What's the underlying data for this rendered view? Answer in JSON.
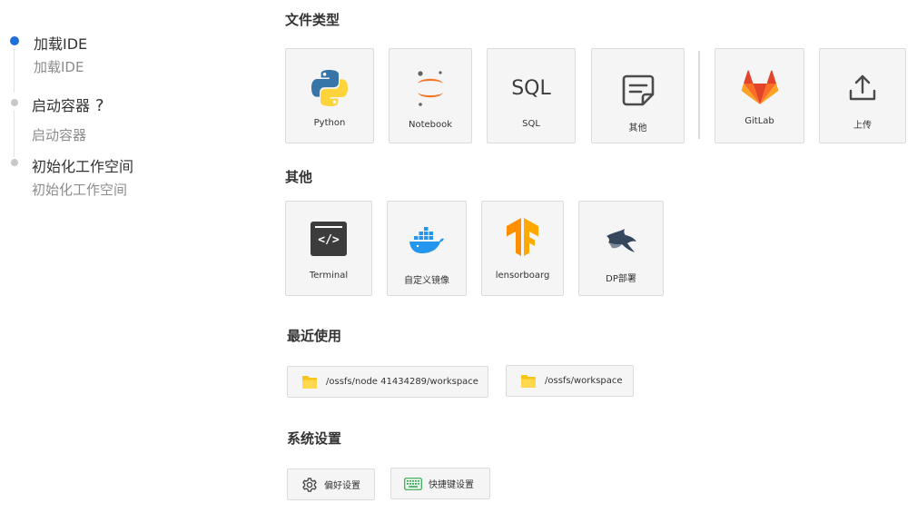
{
  "steps": [
    {
      "title": "加载IDE",
      "subtitle": "加载IDE",
      "active": true
    },
    {
      "title": "启动容器",
      "help": "?",
      "subtitle": "启动容器",
      "active": false
    },
    {
      "title": "初始化工作空间",
      "subtitle": "初始化工作空间",
      "active": false
    }
  ],
  "sections": {
    "file_types": "文件类型",
    "other": "其他",
    "recent": "最近使用",
    "settings": "系统设置"
  },
  "file_types": [
    {
      "label": "Python",
      "icon": "python-icon"
    },
    {
      "label": "Notebook",
      "icon": "jupyter-icon"
    },
    {
      "label": "SQL",
      "icon": "sql-icon"
    },
    {
      "label": "其他",
      "icon": "document-icon"
    },
    {
      "label": "GitLab",
      "icon": "gitlab-icon"
    },
    {
      "label": "上传",
      "icon": "upload-icon"
    }
  ],
  "sql_icon_text": "SQL",
  "others": [
    {
      "label": "Terminal",
      "icon": "terminal-icon"
    },
    {
      "label": "自定义镜像",
      "icon": "docker-icon"
    },
    {
      "label": "lensorboarg",
      "icon": "tensorflow-icon"
    },
    {
      "label": "DP部署",
      "icon": "shark-icon"
    }
  ],
  "terminal_icon_text": "</>",
  "recent": [
    {
      "path": "/ossfs/node 41434289/workspace",
      "icon": "folder-icon"
    },
    {
      "path": "/ossfs/workspace",
      "icon": "folder-icon"
    }
  ],
  "settings": [
    {
      "label": "偏好设置",
      "icon": "gear-icon"
    },
    {
      "label": "快捷键设置",
      "icon": "keyboard-icon"
    }
  ],
  "colors": {
    "active_step": "#1f6fd9",
    "folder": "#f5c518",
    "gitlab": "#e24329",
    "tensorflow": "#ff8f00",
    "docker": "#2496ed",
    "keyboard": "#3aa757"
  }
}
